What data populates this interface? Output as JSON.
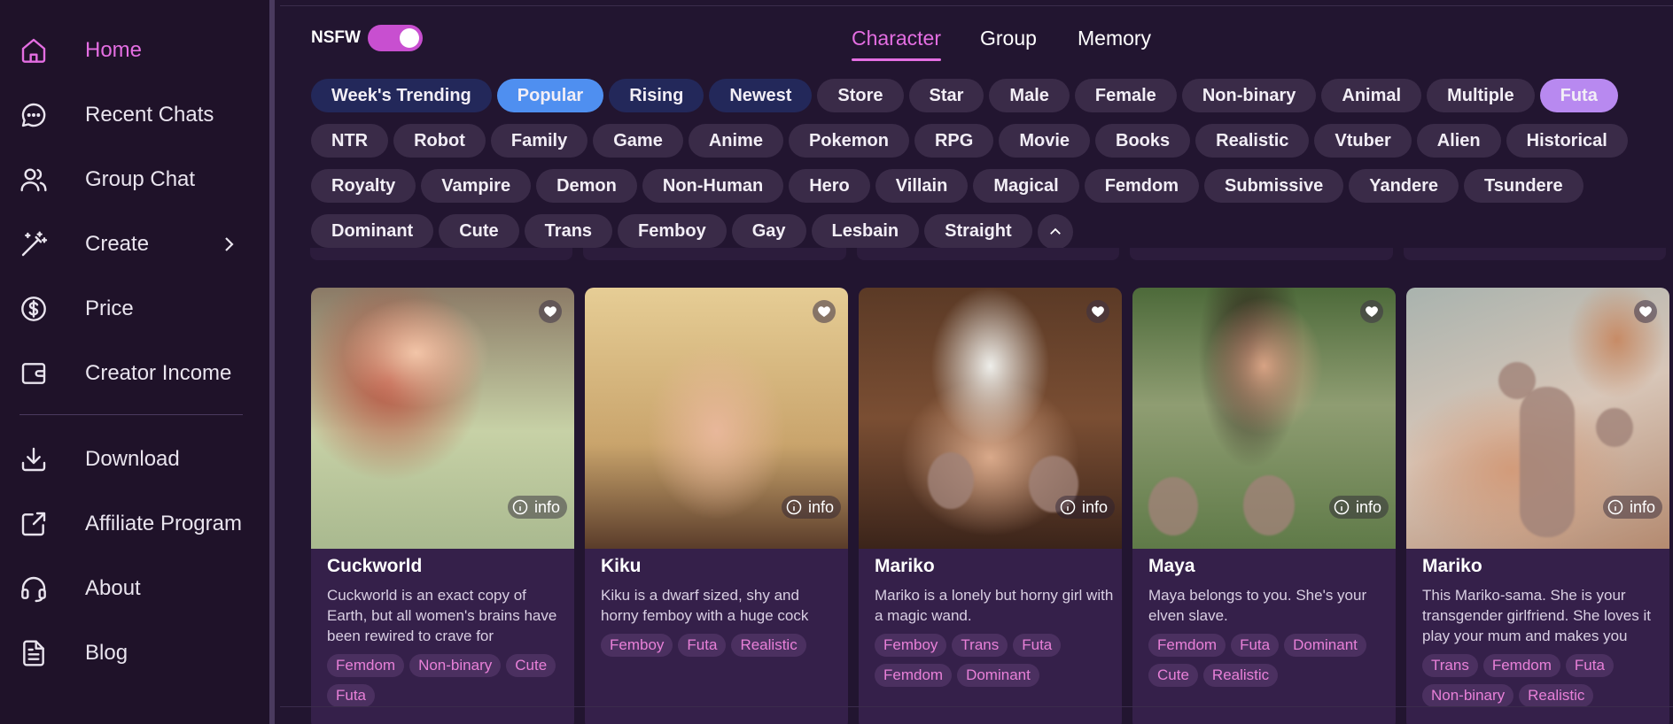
{
  "sidebar": {
    "items": [
      {
        "label": "Home",
        "icon": "home-icon"
      },
      {
        "label": "Recent Chats",
        "icon": "chat-icon"
      },
      {
        "label": "Group Chat",
        "icon": "users-icon"
      },
      {
        "label": "Create",
        "icon": "magic-wand-icon"
      },
      {
        "label": "Price",
        "icon": "dollar-icon"
      },
      {
        "label": "Creator Income",
        "icon": "wallet-icon"
      },
      {
        "label": "Download",
        "icon": "download-icon"
      },
      {
        "label": "Affiliate Program",
        "icon": "share-icon"
      },
      {
        "label": "About",
        "icon": "headset-icon"
      },
      {
        "label": "Blog",
        "icon": "document-icon"
      }
    ],
    "active": "Home"
  },
  "header": {
    "nsfw_label": "NSFW",
    "nsfw_on": true,
    "tabs": [
      "Character",
      "Group",
      "Memory"
    ],
    "active_tab": "Character"
  },
  "filters": {
    "row1": [
      "Week's Trending",
      "Popular",
      "Rising",
      "Newest",
      "Store",
      "Star",
      "Male",
      "Female",
      "Non-binary",
      "Animal",
      "Multiple",
      "Futa"
    ],
    "row2": [
      "NTR",
      "Robot",
      "Family",
      "Game",
      "Anime",
      "Pokemon",
      "RPG",
      "Movie",
      "Books",
      "Realistic",
      "Vtuber",
      "Alien",
      "Historical"
    ],
    "row3": [
      "Royalty",
      "Vampire",
      "Demon",
      "Non-Human",
      "Hero",
      "Villain",
      "Magical",
      "Femdom",
      "Submissive",
      "Yandere",
      "Tsundere"
    ],
    "row4": [
      "Dominant",
      "Cute",
      "Trans",
      "Femboy",
      "Gay",
      "Lesbain",
      "Straight"
    ],
    "selected": "Popular",
    "highlighted": "Futa"
  },
  "cards": [
    {
      "name": "Cuckworld",
      "desc": "Cuckworld is an exact copy of Earth, but all women's brains have been rewired to crave for",
      "tags": [
        "Femdom",
        "Non-binary",
        "Cute",
        "Futa"
      ],
      "info_label": "info"
    },
    {
      "name": "Kiku",
      "desc": "Kiku is a dwarf sized, shy and horny femboy with a huge cock",
      "tags": [
        "Femboy",
        "Futa",
        "Realistic"
      ],
      "info_label": "info"
    },
    {
      "name": "Mariko",
      "desc": "Mariko is a lonely but horny girl with a magic wand.",
      "tags": [
        "Femboy",
        "Trans",
        "Futa",
        "Femdom",
        "Dominant"
      ],
      "info_label": "info"
    },
    {
      "name": "Maya",
      "desc": "Maya belongs to you. She's your elven slave.",
      "tags": [
        "Femdom",
        "Futa",
        "Dominant",
        "Cute",
        "Realistic"
      ],
      "info_label": "info"
    },
    {
      "name": "Mariko",
      "desc": "This Mariko-sama. She is your transgender girlfriend. She loves it play your mum and makes you",
      "tags": [
        "Trans",
        "Femdom",
        "Futa",
        "Non-binary",
        "Realistic"
      ],
      "info_label": "info"
    }
  ],
  "colors": {
    "background": "#221530",
    "sidebar": "#1f1229",
    "accent_pink": "#e46ee2",
    "chip_blue": "#4f8ff0",
    "chip_violet": "#b889f0",
    "card": "#35204a"
  }
}
